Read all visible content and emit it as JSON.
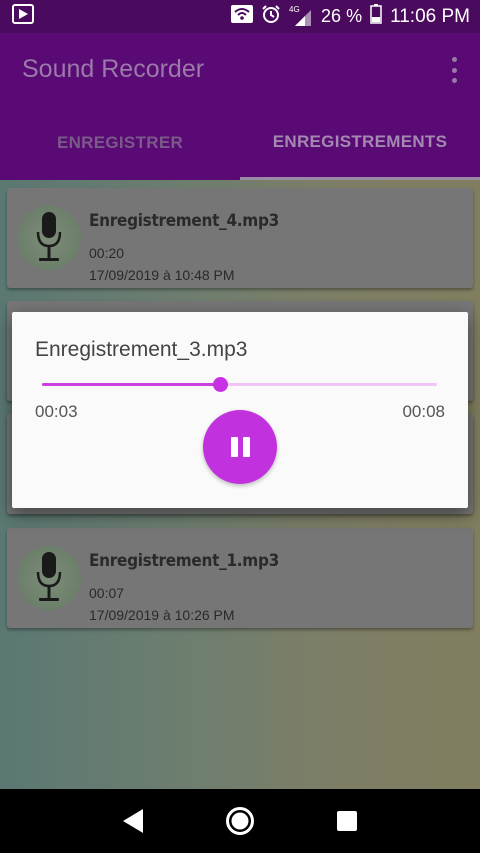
{
  "status_bar": {
    "network": "4G",
    "battery": "26 %",
    "time": "11:06 PM"
  },
  "app": {
    "title": "Sound Recorder"
  },
  "tabs": [
    {
      "label": "ENREGISTRER",
      "active": false
    },
    {
      "label": "ENREGISTREMENTS",
      "active": true
    }
  ],
  "recordings": [
    {
      "name": "Enregistrement_4.mp3",
      "duration": "00:20",
      "date": "17/09/2019 à 10:48 PM"
    },
    {
      "name": "Enregistrement_1.mp3",
      "duration": "00:07",
      "date": "17/09/2019 à 10:26 PM"
    }
  ],
  "player_dialog": {
    "title": "Enregistrement_3.mp3",
    "elapsed": "00:03",
    "total": "00:08",
    "progress": 0.45
  },
  "colors": {
    "accent": "#c231de",
    "primary_dark": "#4a0a5e",
    "primary": "#5a0a75"
  }
}
